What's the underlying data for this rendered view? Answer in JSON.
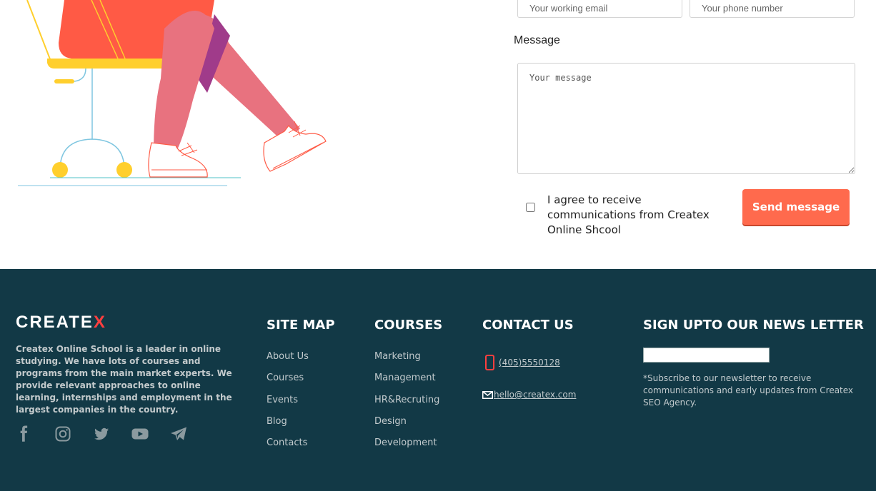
{
  "form": {
    "email_placeholder": "Your working email",
    "phone_placeholder": "Your phone number",
    "message_label": "Message",
    "message_placeholder": "Your message",
    "agree_text": "I agree to receive communications from Createx Online Shcool",
    "send_label": "Send message"
  },
  "footer": {
    "logo_main": "CREATE",
    "logo_accent": "X",
    "about": "Createx Online School is a leader in online studying. We have lots of courses and programs from the main market experts. We provide relevant approaches to online learning, internships and employment in the largest companies in the country.",
    "social_icons": [
      "facebook-icon",
      "instagram-icon",
      "twitter-icon",
      "youtube-icon",
      "telegram-icon"
    ],
    "sitemap": {
      "title": "SITE MAP",
      "links": [
        "About Us",
        "Courses",
        "Events",
        "Blog",
        "Contacts"
      ]
    },
    "courses": {
      "title": "COURSES",
      "links": [
        "Marketing",
        "Management",
        "HR&Recruting",
        "Design",
        "Development"
      ]
    },
    "contact": {
      "title": "CONTACT US",
      "phone": "(405)5550128",
      "email": "hello@createx.com"
    },
    "newsletter": {
      "title": "SIGN UPTO OUR NEWS LETTER",
      "note": "*Subscribe to our newsletter to receive communications and early updates from Createx SEO Agency."
    }
  },
  "colors": {
    "accent": "#ff6a4d",
    "footer_bg": "#123946",
    "logo_accent": "#ff3f3f"
  }
}
